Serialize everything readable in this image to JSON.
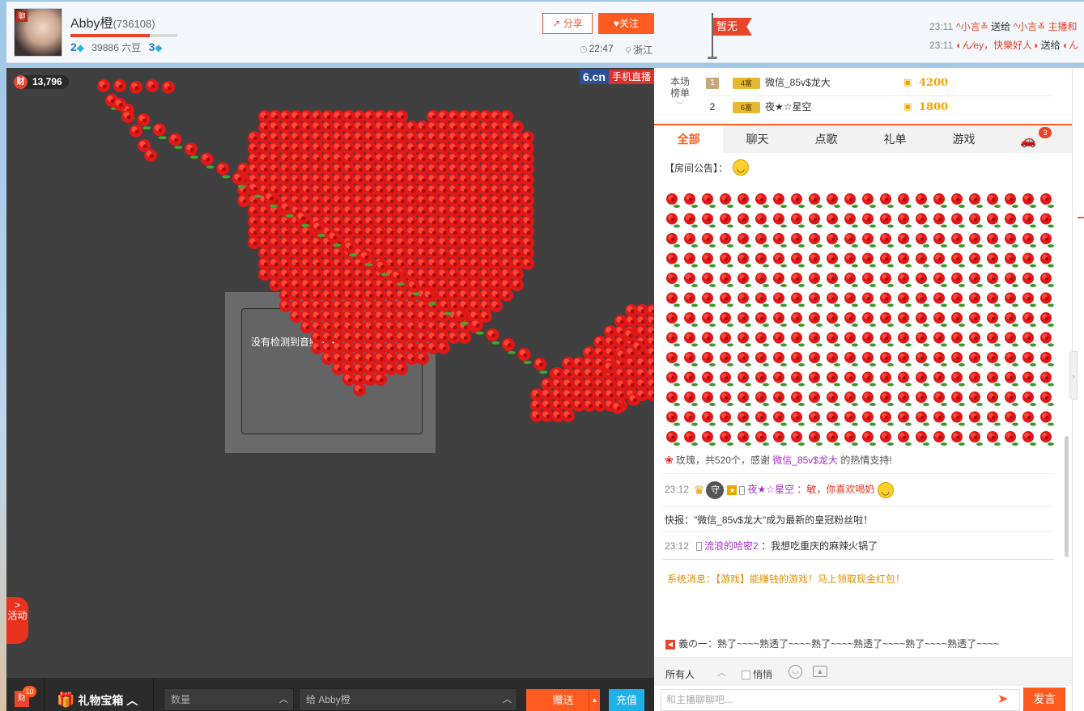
{
  "header": {
    "avatar_badge": "聊",
    "anchor_name": "Abby橙",
    "room_id": "(736108)",
    "level_progress": 0.74,
    "level_left": "2",
    "beans": "39886 六豆",
    "level_right": "3",
    "share_label": "分享",
    "follow_label": "关注",
    "time": "22:47",
    "location": "浙江",
    "flag_text": "暂无"
  },
  "gift_feed": [
    {
      "time": "23:11",
      "user": "^小言≚",
      "action": "送给",
      "to": "^小言≚ 主播和"
    },
    {
      "time": "23:11",
      "user": "◐ん∕ey，快樂好人◑",
      "action": "送给",
      "to": "◐ん"
    }
  ],
  "video": {
    "wealth_icon": "财",
    "wealth_count": "13,796",
    "logo_left": "6.cn",
    "logo_right": "手机直播",
    "no_audio_text": "没有检测到音频设备",
    "activity_label": "活动"
  },
  "gift_bar": {
    "gift_icon": "财",
    "gift_count": "10",
    "gift_box_label": "礼物宝箱",
    "qty_placeholder": "数量",
    "recipient_prefix": "给",
    "recipient_name": "Abby橙",
    "send_label": "赠送",
    "recharge_label": "充值"
  },
  "ranking": {
    "label_line1": "本场",
    "label_line2": "榜单",
    "rows": [
      {
        "rank": "1",
        "level": "4富",
        "name": "微信_85v$龙大",
        "score": "4200"
      },
      {
        "rank": "2",
        "level": "6富",
        "name": "夜★☆星空",
        "score": "1800"
      }
    ]
  },
  "tabs": [
    "全部",
    "聊天",
    "点歌",
    "礼单",
    "游戏"
  ],
  "car_badge": "3",
  "chat": {
    "announce_label": "【房间公告】：",
    "rose_msg_prefix": "玫瑰，共520个，感谢",
    "rose_msg_user": "微信_85v$龙大",
    "rose_msg_suffix": "的热情支持!",
    "msg1_time": "23:12",
    "msg1_user": "夜★☆星空",
    "msg1_text": "：敏，你喜欢喝奶",
    "fast_report": "快报：\"微信_85v$龙大\"成为最新的皇冠粉丝啦！",
    "msg2_time": "23:12",
    "msg2_user": "流浪的哈密2",
    "msg2_text": "：我想吃重庆的麻辣火锅了",
    "system_msg": "系统消息：【游戏】能赚钱的游戏！马上领取现金红包！",
    "broadcast": "義の一：熟了~~~~熟透了~~~~熟了~~~~熟透了~~~~熟了~~~~熟透了~~~~"
  },
  "chat_toolbar": {
    "to_label": "所有人",
    "whisper_label": "悄悄",
    "input_placeholder": "和主播聊聊吧...",
    "send_label": "发言"
  },
  "colors": {
    "accent": "#ff5a1f",
    "rose": "#e32020",
    "purple_user": "#a333c8"
  }
}
